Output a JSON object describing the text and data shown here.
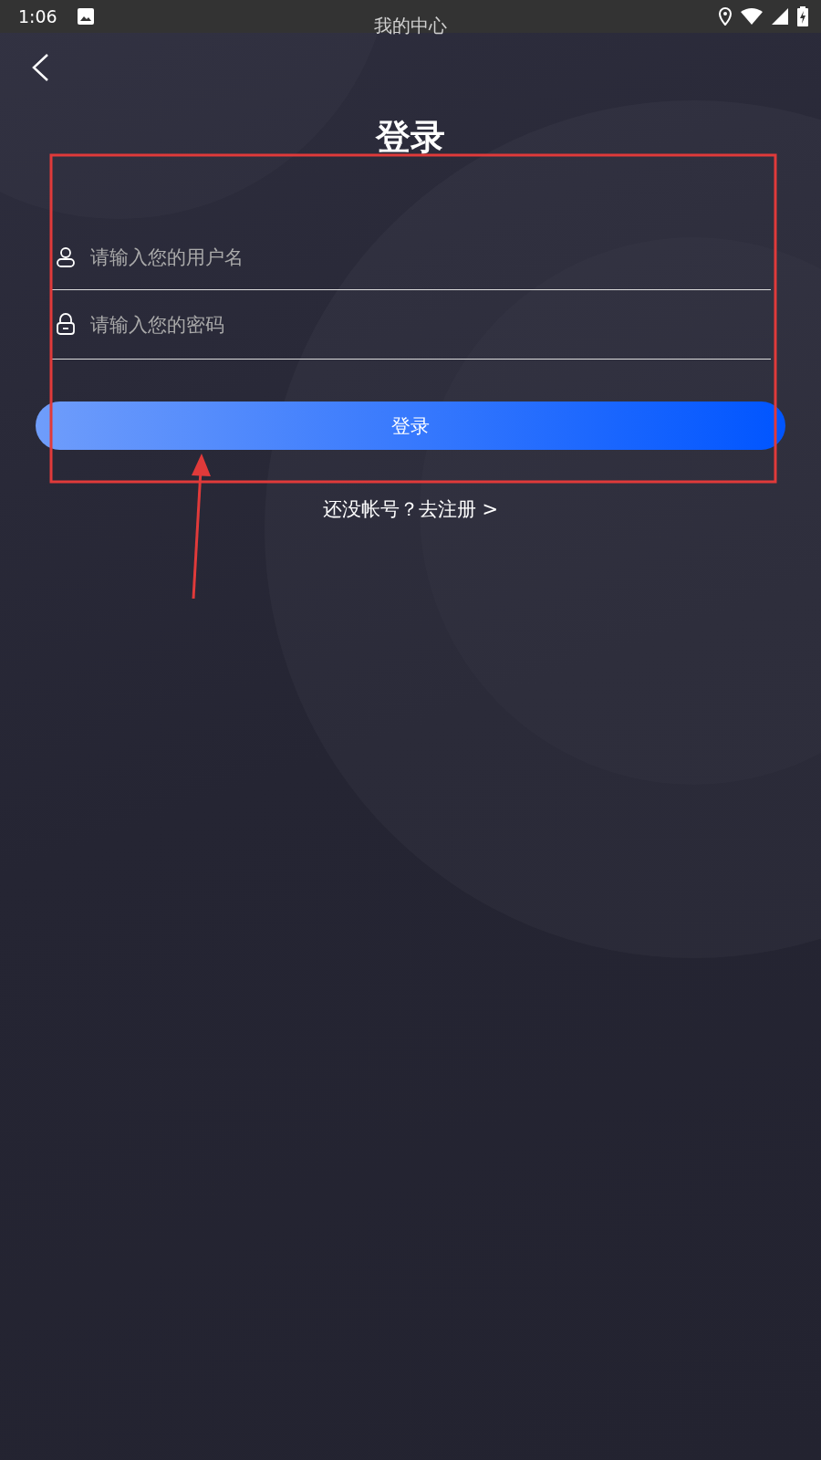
{
  "status_bar": {
    "time": "1:06"
  },
  "page_heading": "我的中心",
  "title": "登录",
  "fields": [
    {
      "kind": "user",
      "placeholder": "请输入您的用户名"
    },
    {
      "kind": "password",
      "placeholder": "请输入您的密码"
    }
  ],
  "login_button": "登录",
  "register_link": "还没帐号？去注册 >"
}
